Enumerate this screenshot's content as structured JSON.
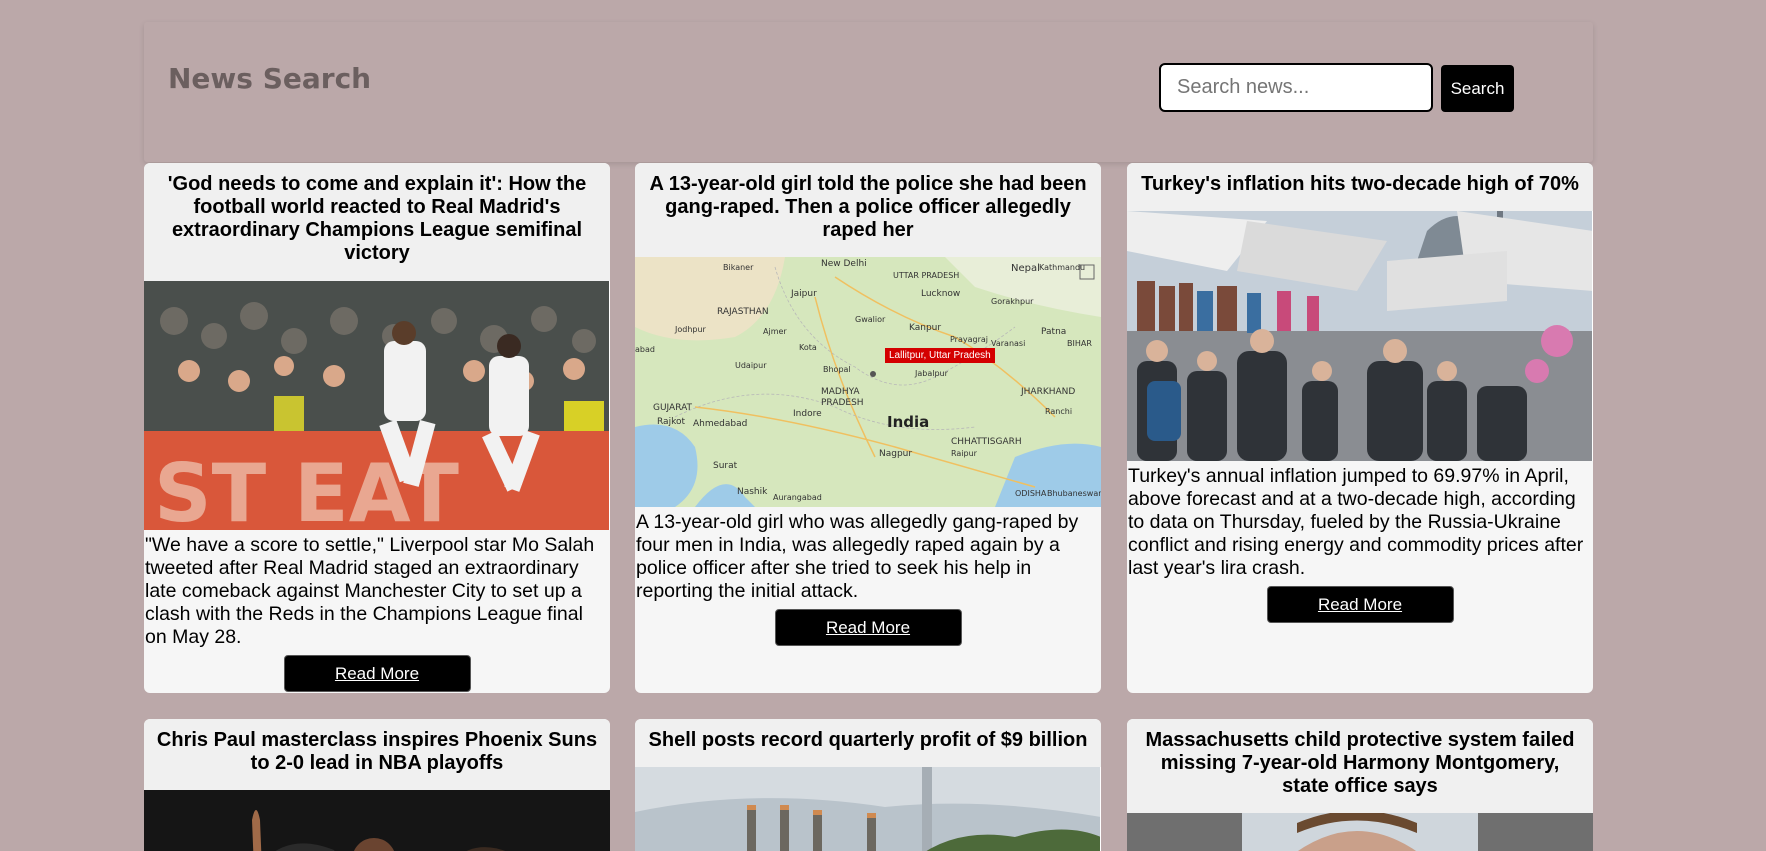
{
  "header": {
    "brand": "News Search",
    "search_placeholder": "Search news...",
    "search_button": "Search"
  },
  "colors": {
    "page_bg": "#bba8a9",
    "card_bg": "#f6f6f6",
    "button_bg": "#000000",
    "map_pin": "#d40000"
  },
  "articles": [
    {
      "title": "'God needs to come and explain it': How the football world reacted to Real Madrid's extraordinary Champions League semifinal victory",
      "description": "\"We have a score to settle,\" Liverpool star Mo Salah tweeted after Real Madrid staged an extraordinary late comeback against Manchester City to set up a clash with the Reds in the Champions League final on May 28.",
      "button": "Read More",
      "image": "football-celebration-photo"
    },
    {
      "title": "A 13-year-old girl told the police she had been gang-raped. Then a police officer allegedly raped her",
      "description": "A 13-year-old girl who was allegedly gang-raped by four men in India, was allegedly raped again by a police officer after she tried to seek his help in reporting the initial attack.",
      "button": "Read More",
      "image": "india-map",
      "map": {
        "pin_label": "Lallitpur, Uttar Pradesh",
        "country_label": "India",
        "labels": [
          "New Delhi",
          "Jaipur",
          "RAJASTHAN",
          "UTTAR PRADESH",
          "Lucknow",
          "Kanpur",
          "Nepal",
          "Kathmandu",
          "MADHYA PRADESH",
          "GUJARAT",
          "Ahmedabad",
          "Rajkot",
          "Indore",
          "Surat",
          "Nagpur",
          "Nashik",
          "Aurangabad",
          "CHHATTISGARH",
          "JHARKHAND",
          "BIHAR",
          "Patna",
          "Raipur",
          "Jodhpur",
          "Udaipur",
          "Ajmer",
          "Gwalior",
          "Kota",
          "Bhopal",
          "Jabalpur",
          "Prayagraj",
          "Varanasi",
          "Gorakhpur",
          "Ranchi",
          "ODISHA",
          "Bhubaneswar",
          "Bikaner"
        ]
      }
    },
    {
      "title": "Turkey's inflation hits two-decade high of 70%",
      "description": "Turkey's annual inflation jumped to 69.97% in April, above forecast and at a two-decade high, according to data on Thursday, fueled by the Russia-Ukraine conflict and rising energy and commodity prices after last year's lira crash.",
      "button": "Read More",
      "image": "istanbul-market-photo"
    },
    {
      "title": "Chris Paul masterclass inspires Phoenix Suns to 2-0 lead in NBA playoffs",
      "image": "basketball-photo"
    },
    {
      "title": "Shell posts record quarterly profit of $9 billion",
      "image": "refinery-photo"
    },
    {
      "title": "Massachusetts child protective system failed missing 7-year-old Harmony Montgomery, state office says",
      "image": "child-photo"
    }
  ]
}
